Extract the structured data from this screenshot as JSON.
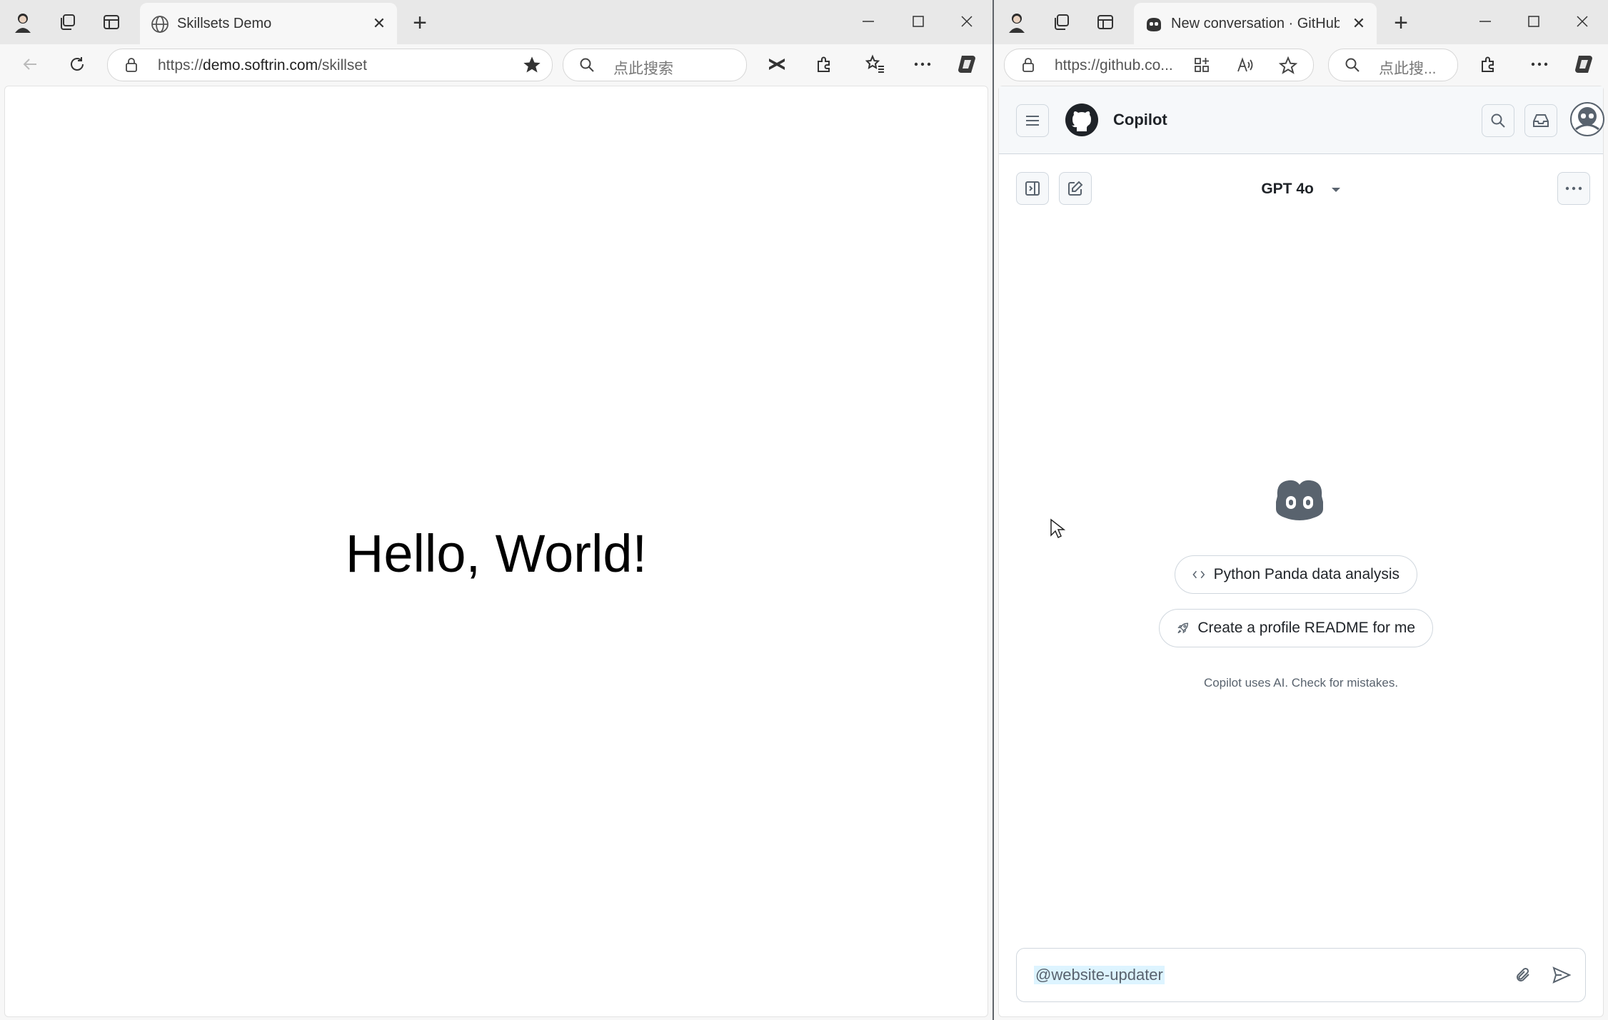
{
  "left_window": {
    "tab": {
      "title": "Skillsets Demo",
      "favicon": "globe-icon"
    },
    "address": {
      "prefix": "https://",
      "host": "demo.softrin.com",
      "path": "/skillset"
    },
    "search": {
      "placeholder": "点此搜索"
    },
    "page": {
      "heading": "Hello, World!"
    }
  },
  "right_window": {
    "tab": {
      "title": "New conversation · GitHub Co",
      "favicon": "copilot-icon"
    },
    "address": {
      "text": "https://github.co..."
    },
    "search": {
      "placeholder": "点此搜..."
    },
    "copilot": {
      "app_title": "Copilot",
      "model": "GPT 4o",
      "suggestions": [
        {
          "label": "Python Panda data analysis",
          "icon": "code-icon"
        },
        {
          "label": "Create a profile README for me",
          "icon": "rocket-icon"
        }
      ],
      "disclaimer": "Copilot uses AI. Check for mistakes.",
      "input_value": "@website-updater"
    }
  },
  "colors": {
    "tabbar": "#e8e8e8",
    "toolbar": "#f7f7f7",
    "gh_border": "#d0d7de",
    "gh_text": "#1f2328",
    "mention_bg": "#ddf4ff"
  }
}
